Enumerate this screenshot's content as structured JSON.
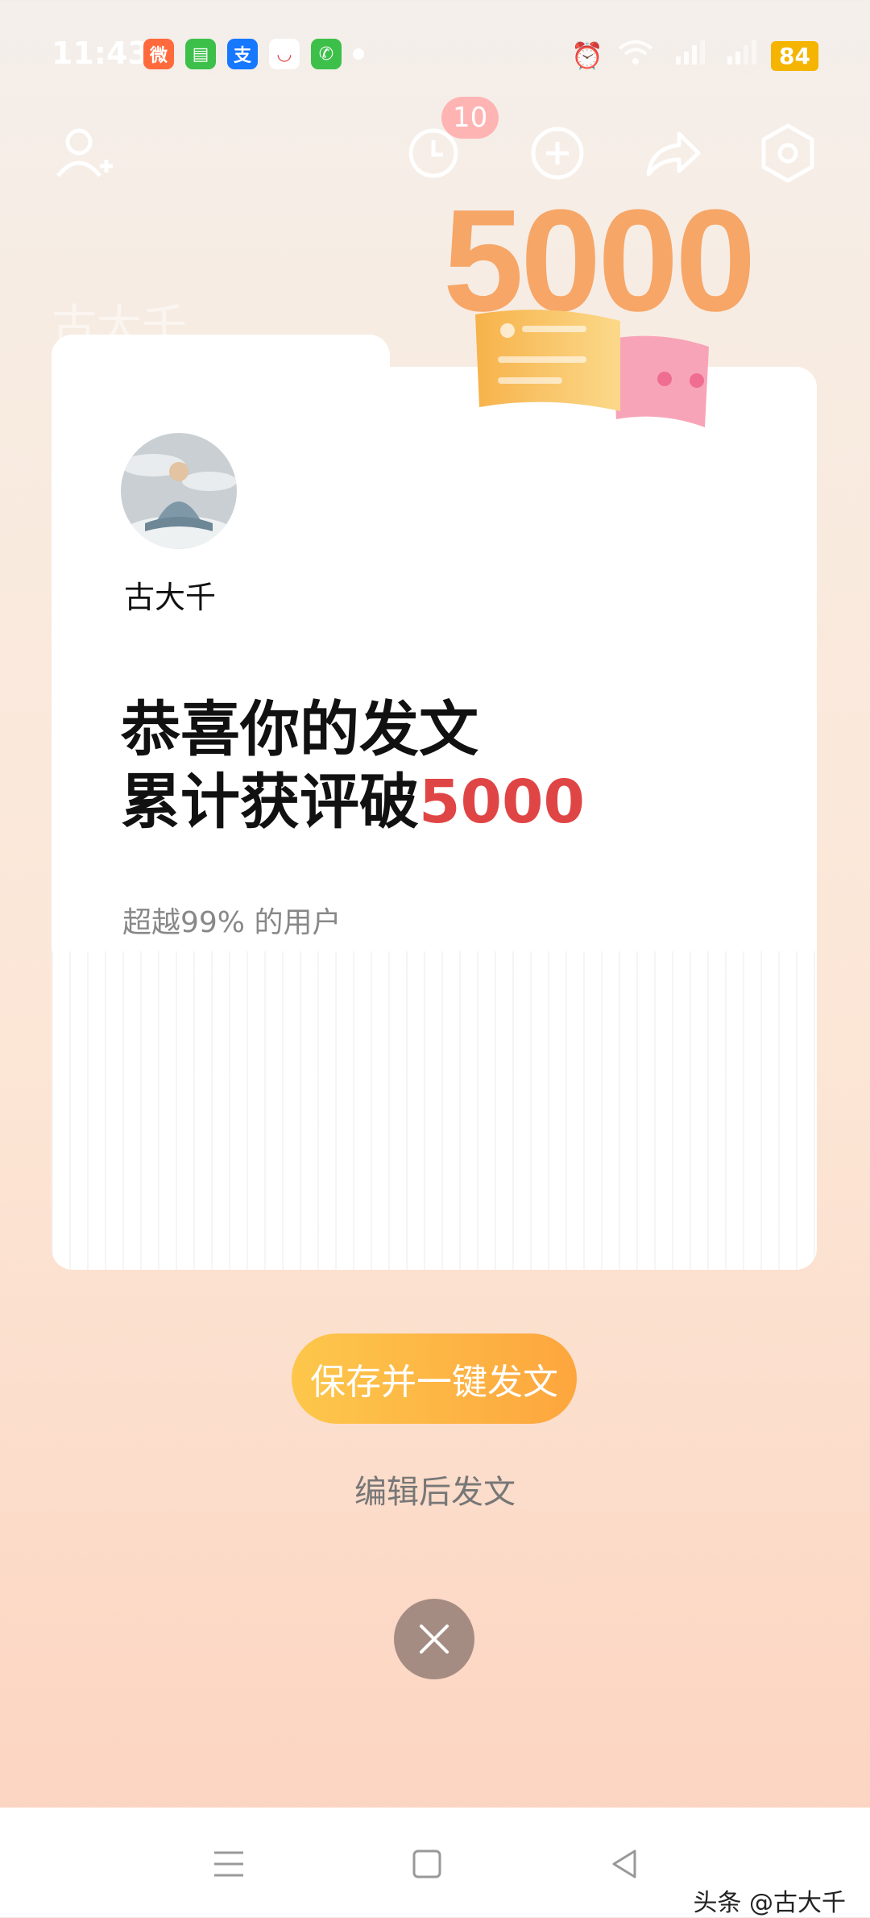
{
  "status_bar": {
    "time": "11:43",
    "battery": "84",
    "apps": [
      {
        "name": "wechat",
        "glyph": "微",
        "color": "#ff6a3d"
      },
      {
        "name": "messages",
        "glyph": "▤",
        "color": "#3cc04a"
      },
      {
        "name": "alipay",
        "glyph": "支",
        "color": "#1677ff"
      },
      {
        "name": "app-cup",
        "glyph": "◡",
        "color": "#ffffff"
      },
      {
        "name": "phone",
        "glyph": "✆",
        "color": "#3cc04a"
      }
    ]
  },
  "top_actions": {
    "notification_count": "10"
  },
  "card": {
    "username": "古大千",
    "headline_line1": "恭喜你的发文",
    "headline_line2_prefix": "累计获评破",
    "headline_number": "5000",
    "subtext": "超越99% 的用户",
    "decor_number": "5000",
    "ghost_name": "古大千"
  },
  "actions": {
    "primary": "保存并一键发文",
    "secondary": "编辑后发文"
  },
  "watermark": "头条 @古大千",
  "colors": {
    "accent_red": "#e04545",
    "button_start": "#fdc74b",
    "button_end": "#fda63e",
    "close_bg": "#a58c82"
  }
}
